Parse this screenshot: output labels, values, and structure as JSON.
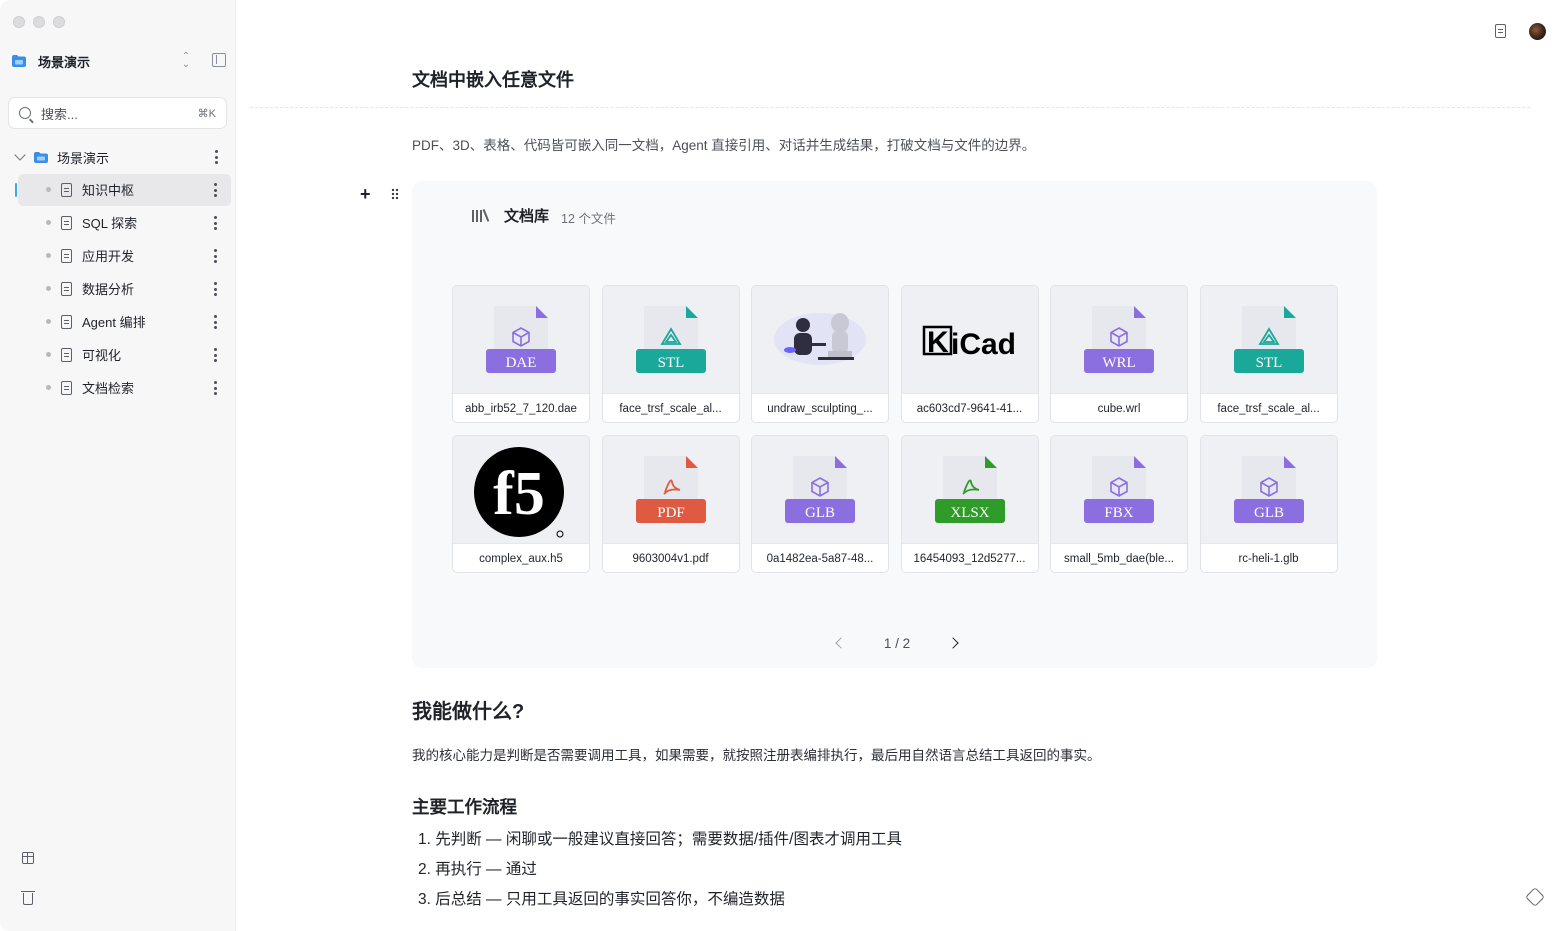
{
  "sidebar": {
    "workspace_title": "场景演示",
    "search_placeholder": "搜索...",
    "search_shortcut": "⌘K",
    "tree_root_label": "场景演示",
    "items": [
      {
        "label": "知识中枢",
        "active": true
      },
      {
        "label": "SQL 探索",
        "active": false
      },
      {
        "label": "应用开发",
        "active": false
      },
      {
        "label": "数据分析",
        "active": false
      },
      {
        "label": "Agent 编排",
        "active": false
      },
      {
        "label": "可视化",
        "active": false
      },
      {
        "label": "文档检索",
        "active": false
      }
    ]
  },
  "main": {
    "title": "文档中嵌入任意文件",
    "lead": "PDF、3D、表格、代码皆可嵌入同一文档，Agent 直接引用、对话并生成结果，打破文档与文件的边界。",
    "library": {
      "title": "文档库",
      "count": "12 个文件",
      "files": [
        {
          "name": "abb_irb52_7_120.dae",
          "kind": "DAE",
          "color": "#8b6ee0"
        },
        {
          "name": "face_trsf_scale_al...",
          "kind": "STL",
          "color": "#1aa89a"
        },
        {
          "name": "undraw_sculpting_...",
          "kind": "image",
          "color": "#6c63ff"
        },
        {
          "name": "ac603cd7-9641-41...",
          "kind": "KiCad",
          "color": "#000000"
        },
        {
          "name": "cube.wrl",
          "kind": "WRL",
          "color": "#8b6ee0"
        },
        {
          "name": "face_trsf_scale_al...",
          "kind": "STL",
          "color": "#1aa89a"
        },
        {
          "name": "complex_aux.h5",
          "kind": "f5",
          "color": "#000000"
        },
        {
          "name": "9603004v1.pdf",
          "kind": "PDF",
          "color": "#e05a42"
        },
        {
          "name": "0a1482ea-5a87-48...",
          "kind": "GLB",
          "color": "#8b6ee0"
        },
        {
          "name": "16454093_12d5277...",
          "kind": "XLSX",
          "color": "#2f9c2a"
        },
        {
          "name": "small_5mb_dae(ble...",
          "kind": "FBX",
          "color": "#8b6ee0"
        },
        {
          "name": "rc-heli-1.glb",
          "kind": "GLB",
          "color": "#8b6ee0"
        }
      ],
      "page": "1 / 2"
    },
    "section_title": "我能做什么?",
    "section_text": "我的核心能力是判断是否需要调用工具，如果需要，就按照注册表编排执行，最后用自然语言总结工具返回的事实。",
    "workflow_title": "主要工作流程",
    "workflow_steps": [
      "1. 先判断 — 闲聊或一般建议直接回答；需要数据/插件/图表才调用工具",
      "2. 再执行 — 通过",
      "3. 后总结 — 只用工具返回的事实回答你，不编造数据"
    ]
  }
}
